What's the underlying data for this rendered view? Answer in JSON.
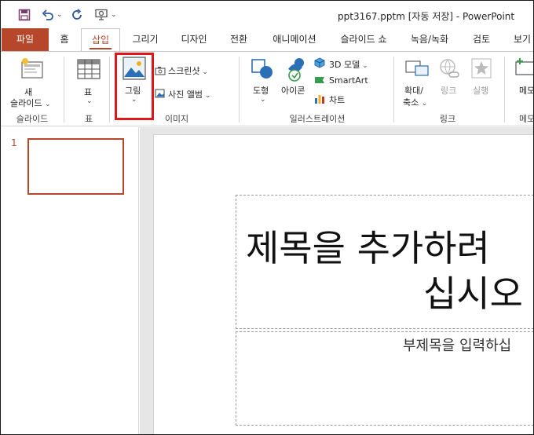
{
  "titlebar": {
    "document_title": "ppt3167.pptm [자동 저장]  -  PowerPoint"
  },
  "tabs": [
    {
      "label": "파일"
    },
    {
      "label": "홈"
    },
    {
      "label": "삽입"
    },
    {
      "label": "그리기"
    },
    {
      "label": "디자인"
    },
    {
      "label": "전환"
    },
    {
      "label": "애니메이션"
    },
    {
      "label": "슬라이드 쇼"
    },
    {
      "label": "녹음/녹화"
    },
    {
      "label": "검토"
    },
    {
      "label": "보기"
    }
  ],
  "ribbon": {
    "new_slide_line1": "새",
    "new_slide_line2": "슬라이드",
    "table": "표",
    "picture": "그림",
    "screenshot": "스크린샷",
    "photo_album": "사진 앨범",
    "shapes": "도형",
    "icons": "아이콘",
    "model3d": "3D 모델",
    "smartart": "SmartArt",
    "chart": "차트",
    "zoom_line1": "확대/",
    "zoom_line2": "축소",
    "link": "링크",
    "action": "실행",
    "comment": "메모",
    "groups": {
      "slides": "슬라이드",
      "tables": "표",
      "images": "이미지",
      "illustrations": "일러스트레이션",
      "links": "링크",
      "comments": "메모"
    }
  },
  "thumbnails": {
    "slide_number": "1"
  },
  "slide": {
    "title_line1": "제목을 추가하려",
    "title_line2": "십시오",
    "subtitle": "부제목을 입력하십"
  },
  "colors": {
    "accent": "#b7472a",
    "highlight": "#e0161d"
  }
}
